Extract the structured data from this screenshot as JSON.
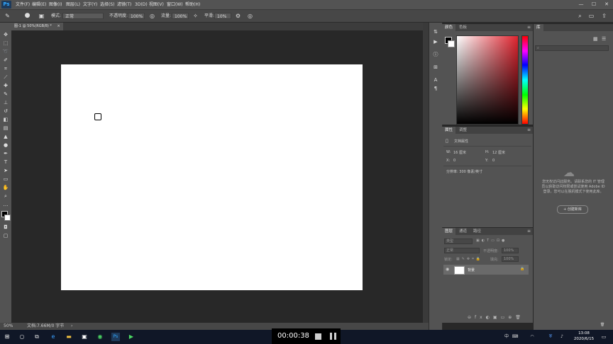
{
  "menubar": {
    "logo": "Ps",
    "items": [
      "文件(F)",
      "编辑(E)",
      "图像(I)",
      "图层(L)",
      "文字(Y)",
      "选择(S)",
      "滤镜(T)",
      "3D(D)",
      "视图(V)",
      "窗口(W)",
      "帮助(H)"
    ],
    "win_min": "—",
    "win_max": "☐",
    "win_close": "✕"
  },
  "options": {
    "mode_label": "模式:",
    "mode_value": "正常",
    "opacity_label": "不透明度:",
    "opacity_value": "100%",
    "flow_label": "流量:",
    "flow_value": "100%",
    "smooth_label": "平滑:",
    "smooth_value": "10%"
  },
  "document": {
    "tab_title": "图-1 @ 50%(RGB/8) *",
    "tab_close": "×",
    "status_zoom": "50%",
    "status_doc": "文档:7.66M/0 字节"
  },
  "color_panel": {
    "tab1": "颜色",
    "tab2": "色板"
  },
  "properties_panel": {
    "tab1": "属性",
    "tab2": "调整",
    "section": "文档属性",
    "w_label": "W:",
    "w_value": "16 厘米",
    "h_label": "H:",
    "h_value": "12 厘米",
    "x_label": "X:",
    "x_value": "0",
    "y_label": "Y:",
    "y_value": "0",
    "resolution": "分辨率: 300 像素/英寸"
  },
  "layers_panel": {
    "tab1": "图层",
    "tab2": "通道",
    "tab3": "路径",
    "filter_placeholder": "类型",
    "blend_mode": "正常",
    "opacity_label": "不透明度:",
    "opacity_value": "100%",
    "lock_label": "锁定:",
    "fill_label": "填充:",
    "fill_value": "100%",
    "layer_name": "背景"
  },
  "libraries_panel": {
    "tab": "库",
    "message": "您无权访问此服务。请联系您的 IT 管理员以获取访问权限或尝试使用 Adobe ID 登录。您可以在脱机模式下使用此库。",
    "create_button": "+ 创建新库"
  },
  "taskbar": {
    "time": "13:08",
    "date": "2020/6/15",
    "input_lang": "中"
  },
  "recorder": {
    "timer": "00:00:38"
  }
}
